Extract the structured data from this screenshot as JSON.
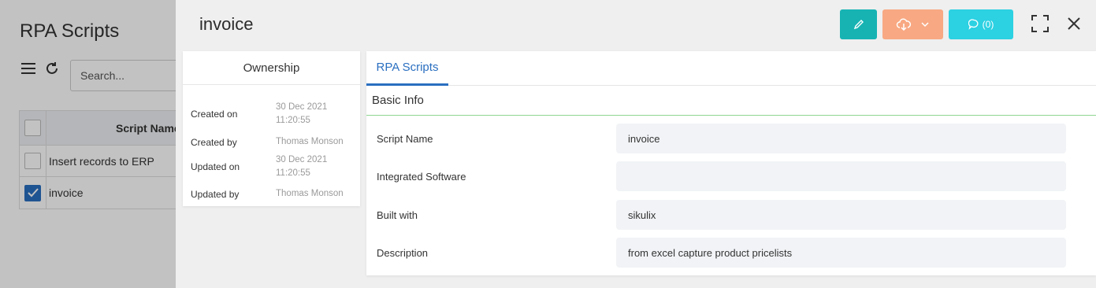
{
  "background": {
    "title": "RPA Scripts",
    "search_placeholder": "Search...",
    "table_header": "Script Name",
    "rows": [
      {
        "name": "Insert records to ERP",
        "checked": false
      },
      {
        "name": "invoice",
        "checked": true
      }
    ]
  },
  "drawer": {
    "title": "invoice",
    "comment_count": "(0)"
  },
  "ownership": {
    "title": "Ownership",
    "created_on_label": "Created on",
    "created_on_value": "30 Dec 2021 11:20:55",
    "created_by_label": "Created by",
    "created_by_value": "Thomas Monson",
    "updated_on_label": "Updated on",
    "updated_on_value": "30 Dec 2021 11:20:55",
    "updated_by_label": "Updated by",
    "updated_by_value": "Thomas Monson"
  },
  "tabs": {
    "active": "RPA Scripts"
  },
  "basic_info": {
    "title": "Basic Info",
    "fields": [
      {
        "label": "Script Name",
        "value": "invoice"
      },
      {
        "label": "Integrated Software",
        "value": ""
      },
      {
        "label": "Built with",
        "value": "sikulix"
      },
      {
        "label": "Description",
        "value": "from excel capture product pricelists"
      }
    ]
  },
  "colors": {
    "edit_button": "#17b3b3",
    "download_button": "#f8a882",
    "comment_button": "#2cd1e2",
    "accent": "#2a6fc0"
  }
}
